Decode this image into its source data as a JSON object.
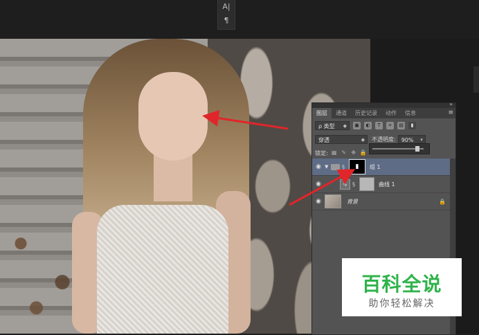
{
  "toolbar_mini": {
    "char_icon": "A|",
    "para_icon": "¶"
  },
  "layers_panel": {
    "tabs": [
      "图层",
      "通道",
      "历史记录",
      "动作",
      "信息"
    ],
    "active_tab": "图层",
    "menu_icon": "≡",
    "collapse_icon": "»",
    "filter": {
      "label": "ρ 类型"
    },
    "blend_mode": "穿透",
    "opacity_label": "不透明度:",
    "opacity_value": "90%",
    "lock_label": "锁定:",
    "layers": [
      {
        "name": "组 1",
        "type": "group",
        "selected": true
      },
      {
        "name": "曲线 1",
        "type": "adjustment"
      },
      {
        "name": "背景",
        "type": "background"
      }
    ]
  },
  "watermark": {
    "title": "百科全说",
    "subtitle": "助你轻松解决"
  },
  "colors": {
    "arrow": "#e0262a",
    "selection": "#5e6c86",
    "watermark_green": "#2fb34a"
  }
}
